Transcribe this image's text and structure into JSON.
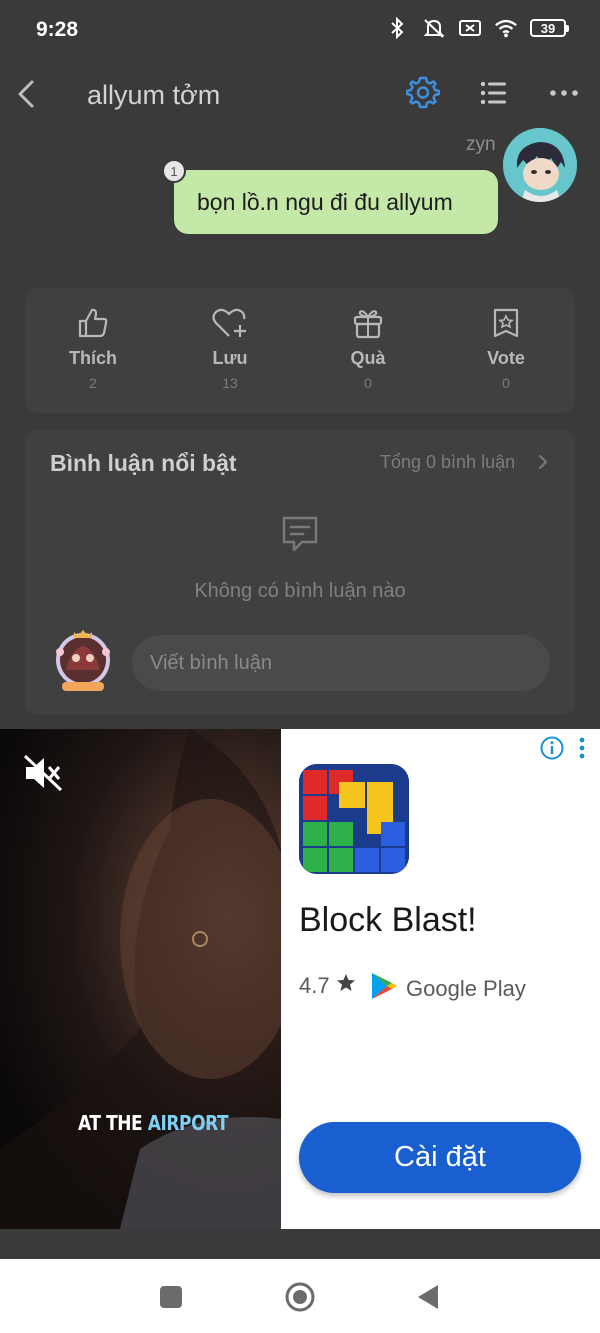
{
  "status": {
    "time": "9:28",
    "battery": "39"
  },
  "header": {
    "title": "allyum tởm"
  },
  "message": {
    "sender": "zyn",
    "badge": "1",
    "text": "bọn lồ.n ngu đi đu allyum"
  },
  "reactions": [
    {
      "label": "Thích",
      "count": "2",
      "icon": "thumbs-up-icon"
    },
    {
      "label": "Lưu",
      "count": "13",
      "icon": "heart-plus-icon"
    },
    {
      "label": "Quà",
      "count": "0",
      "icon": "gift-icon"
    },
    {
      "label": "Vote",
      "count": "0",
      "icon": "vote-badge-icon"
    }
  ],
  "comments": {
    "title": "Bình luận nổi bật",
    "total": "Tổng 0 bình luận",
    "empty": "Không có bình luận nào",
    "input_placeholder": "Viết bình luận"
  },
  "ad": {
    "caption_pre": "AT THE ",
    "caption_hl": "AIRPORT",
    "app_name": "Block Blast!",
    "rating": "4.7",
    "store": "Google Play",
    "install_label": "Cài đặt"
  },
  "colors": {
    "accent": "#3d8fe0",
    "bubble": "#c4e8a8",
    "install": "#1a5fd0"
  }
}
